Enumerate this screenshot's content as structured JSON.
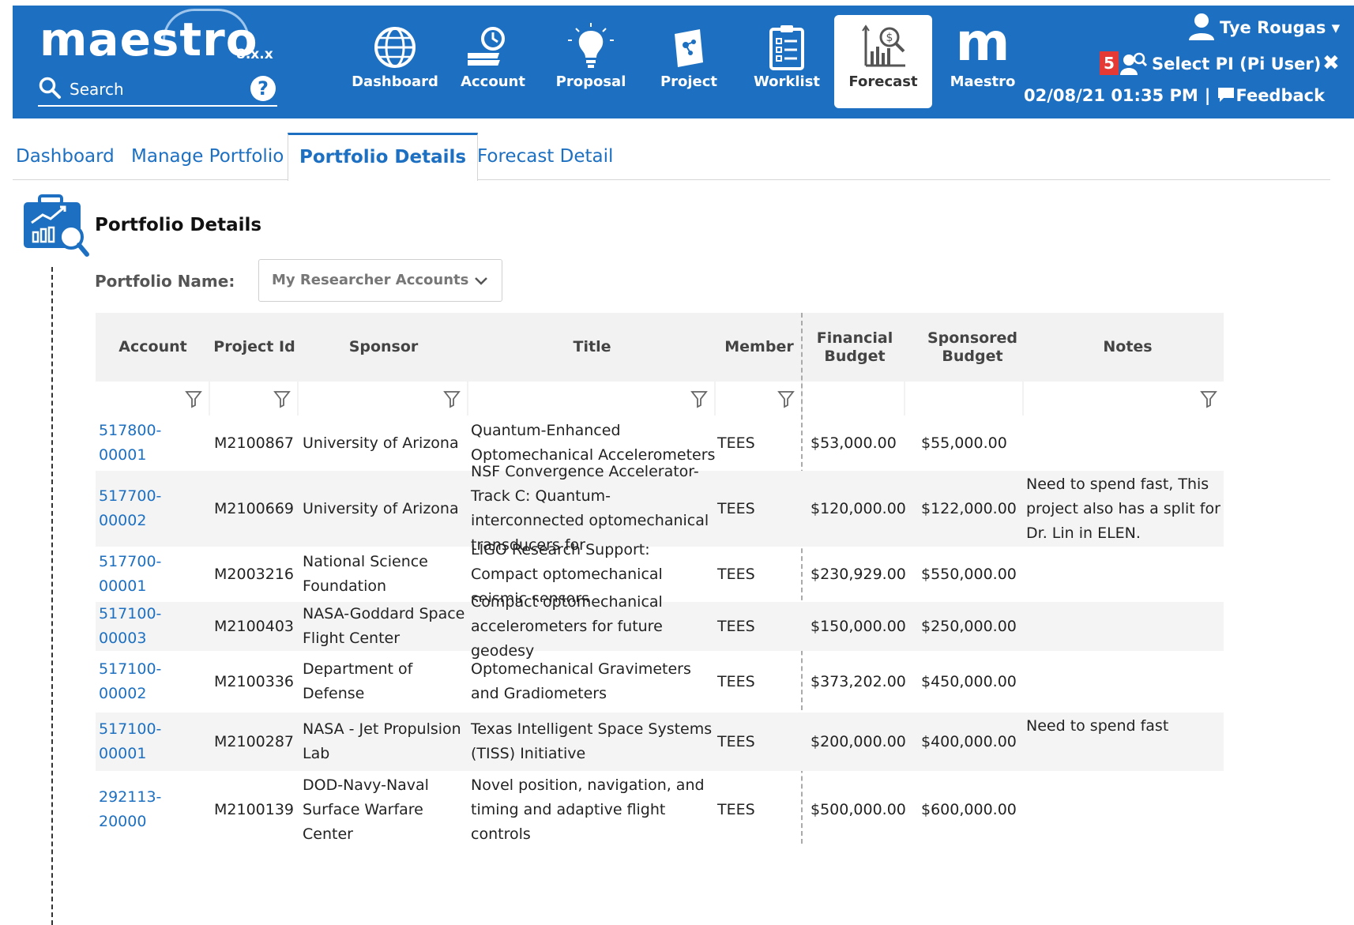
{
  "header": {
    "logo": "maestro",
    "version": "8.x.x",
    "search_label": "Search",
    "help_glyph": "?",
    "nav": [
      {
        "label": "Dashboard",
        "icon": "globe-icon"
      },
      {
        "label": "Account",
        "icon": "account-clock-icon"
      },
      {
        "label": "Proposal",
        "icon": "lightbulb-icon"
      },
      {
        "label": "Project",
        "icon": "project-icon"
      },
      {
        "label": "Worklist",
        "icon": "clipboard-icon"
      },
      {
        "label": "Forecast",
        "icon": "forecast-chart-icon",
        "active": true
      },
      {
        "label": "Maestro",
        "glyph": "m"
      }
    ],
    "user_name": "Tye Rougas ▾",
    "pi_badge": "5",
    "pi_label": "Select PI (Pi User)",
    "pi_close": "✖",
    "datetime": "02/08/21 01:35 PM",
    "separator": "|",
    "feedback": "Feedback"
  },
  "tabs": [
    {
      "label": "Dashboard"
    },
    {
      "label": "Manage Portfolio"
    },
    {
      "label": "Portfolio Details",
      "active": true
    },
    {
      "label": "Forecast Detail"
    }
  ],
  "page": {
    "title": "Portfolio Details",
    "portfolio_label": "Portfolio Name:",
    "portfolio_value": "My Researcher Accounts"
  },
  "table": {
    "columns": [
      "Account",
      "Project Id",
      "Sponsor",
      "Title",
      "Member",
      "Financial Budget",
      "Sponsored Budget",
      "Notes"
    ],
    "rows": [
      {
        "account": "517800-00001",
        "project_id": "M2100867",
        "sponsor": "University of Arizona",
        "title": "Quantum-Enhanced Optomechanical Accelerometers",
        "member": "TEES",
        "financial": "$53,000.00",
        "sponsored": "$55,000.00",
        "notes": ""
      },
      {
        "account": "517700-00002",
        "project_id": "M2100669",
        "sponsor": "University of Arizona",
        "title": "NSF Convergence Accelerator- Track C: Quantum-interconnected optomechanical transducers for",
        "member": "TEES",
        "financial": "$120,000.00",
        "sponsored": "$122,000.00",
        "notes": "Need to spend fast, This project also has a split for Dr. Lin in ELEN."
      },
      {
        "account": "517700-00001",
        "project_id": "M2003216",
        "sponsor": "National Science Foundation",
        "title": "LIGO Research Support: Compact optomechanical seismic sensors",
        "member": "TEES",
        "financial": "$230,929.00",
        "sponsored": "$550,000.00",
        "notes": ""
      },
      {
        "account": "517100-00003",
        "project_id": "M2100403",
        "sponsor": "NASA-Goddard Space Flight Center",
        "title": "Compact optomechanical accelerometers for future geodesy",
        "member": "TEES",
        "financial": "$150,000.00",
        "sponsored": "$250,000.00",
        "notes": ""
      },
      {
        "account": "517100-00002",
        "project_id": "M2100336",
        "sponsor": "Department of Defense",
        "title": "Optomechanical Gravimeters and Gradiometers",
        "member": "TEES",
        "financial": "$373,202.00",
        "sponsored": "$450,000.00",
        "notes": ""
      },
      {
        "account": "517100-00001",
        "project_id": "M2100287",
        "sponsor": "NASA - Jet Propulsion Lab",
        "title": "Texas Intelligent Space Systems (TISS) Initiative",
        "member": "TEES",
        "financial": "$200,000.00",
        "sponsored": "$400,000.00",
        "notes": "Need to spend fast"
      },
      {
        "account": "292113-20000",
        "project_id": "M2100139",
        "sponsor": "DOD-Navy-Naval Surface Warfare Center",
        "title": "Novel position, navigation, and timing and adaptive flight controls",
        "member": "TEES",
        "financial": "$500,000.00",
        "sponsored": "$600,000.00",
        "notes": ""
      }
    ]
  },
  "colors": {
    "brand_blue": "#1d70c1",
    "badge_red": "#e53935"
  }
}
